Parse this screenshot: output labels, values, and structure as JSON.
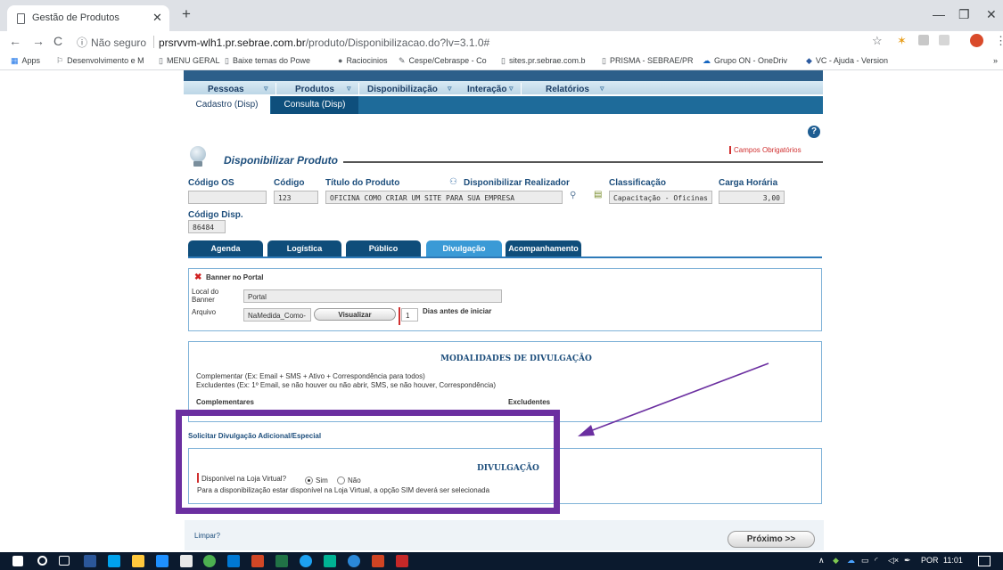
{
  "browser": {
    "tab_title": "Gestão de Produtos",
    "security_label": "Não seguro",
    "url_domain": "prsrvvm-wlh1.pr.sebrae.com.br",
    "url_path": "/produto/Disponibilizacao.do?lv=3.1.0#"
  },
  "bookmarks": [
    "Apps",
    "Desenvolvimento e M",
    "MENU GERAL",
    "Baixe temas do Powe",
    "Raciocinios",
    "Cespe/Cebraspe - Co",
    "sites.pr.sebrae.com.b",
    "PRISMA - SEBRAE/PR",
    "Grupo ON - OneDriv",
    "VC - Ajuda - Version"
  ],
  "menu": {
    "items": [
      "Pessoas",
      "Produtos",
      "Disponibilização",
      "Interação",
      "Relatórios"
    ],
    "sub": [
      "Cadastro (Disp)",
      "Consulta (Disp)"
    ]
  },
  "page": {
    "title": "Disponibilizar Produto",
    "required_label": "Campos Obrigatórios"
  },
  "form": {
    "codigo_os_label": "Código OS",
    "codigo_os": "",
    "codigo_label": "Código",
    "codigo": "123",
    "titulo_label": "Título do Produto",
    "titulo": "OFICINA COMO CRIAR UM SITE PARA SUA EMPRESA",
    "realizador_label": "Disponibilizar Realizador",
    "classificacao_label": "Classificação",
    "classificacao": "Capacitação - Oficinas",
    "carga_label": "Carga Horária",
    "carga": "3,00",
    "codigo_disp_label": "Código Disp.",
    "codigo_disp": "86484"
  },
  "tabs": [
    "Agenda",
    "Logística",
    "Público",
    "Divulgação",
    "Acompanhamento"
  ],
  "banner": {
    "title": "Banner no Portal",
    "local_label": "Local do Banner",
    "local": "Portal",
    "arquivo_label": "Arquivo",
    "arquivo": "NaMedida_Como-",
    "visualizar": "Visualizar",
    "dias_value": "1",
    "dias_label": "Dias antes de iniciar"
  },
  "modalidades": {
    "title": "MODALIDADES DE DIVULGAÇÃO",
    "complementar": "Complementar (Ex: Email + SMS + Ativo + Correspondência para todos)",
    "excludentes": "Excludentes (Ex: 1º Email, se não houver ou não abrir, SMS, se não houver, Correspondência)",
    "col1": "Complementares",
    "col2": "Excludentes"
  },
  "adicional": {
    "link": "Solicitar Divulgação Adicional/Especial"
  },
  "divulgacao": {
    "title": "DIVULGAÇÃO",
    "question": "Disponível na Loja Virtual?",
    "sim": "Sim",
    "nao": "Não",
    "selected": "Sim",
    "note": "Para a disponibilização estar disponível na Loja Virtual, a opção SIM deverá ser selecionada"
  },
  "footer": {
    "limpar": "Limpar?",
    "proximo": "Próximo >>"
  },
  "taskbar": {
    "lang": "POR",
    "time": "11:01"
  },
  "colors": {
    "highlight": "#6b2fa0",
    "tab_dark": "#0f4d7a",
    "tab_active": "#3a9ad6",
    "required": "#d03030"
  }
}
